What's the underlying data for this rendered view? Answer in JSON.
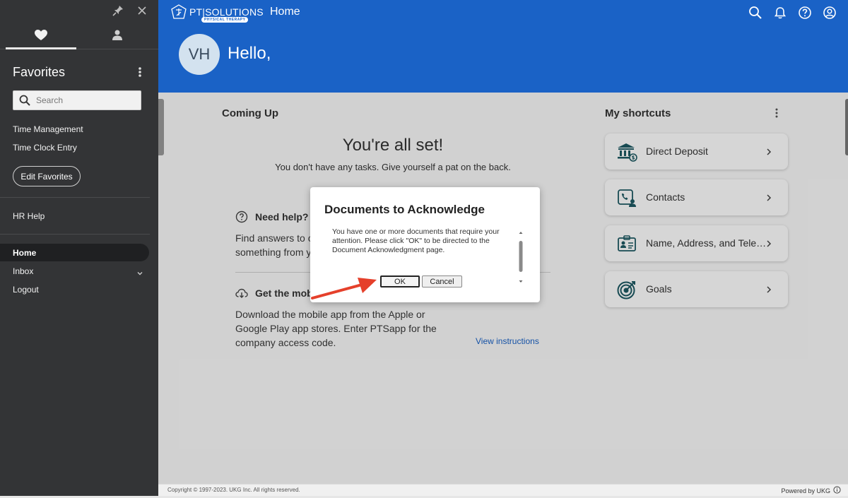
{
  "sidebar": {
    "title": "Favorites",
    "search_placeholder": "Search",
    "favorites": [
      "Time Management",
      "Time Clock Entry"
    ],
    "edit_favorites": "Edit Favorites",
    "hr_help": "HR Help",
    "nav": [
      {
        "label": "Home",
        "active": true
      },
      {
        "label": "Inbox",
        "has_chevron": true
      },
      {
        "label": "Logout"
      }
    ],
    "tabs": [
      {
        "icon": "heart-icon",
        "active": true
      },
      {
        "icon": "person-icon",
        "active": false
      }
    ]
  },
  "header": {
    "logo_text": "PT|SOLUTIONS",
    "logo_subtext": "PHYSICAL THERAPY",
    "page_name": "Home",
    "avatar_initials": "VH",
    "greeting": "Hello,",
    "icons": [
      "search-icon",
      "bell-icon",
      "help-icon",
      "account-icon"
    ]
  },
  "coming_up": {
    "title": "Coming Up",
    "headline": "You're all set!",
    "subtext": "You don't have any tasks. Give yourself a pat on the back."
  },
  "help": {
    "title": "Need help?",
    "text_line1": "Find answers to co",
    "text_line2": "something from yo"
  },
  "mobile": {
    "title": "Get the mobi",
    "text_line1": "Download the mobile app from the Apple or",
    "text_line2": "Google Play app stores. Enter PTSapp for the",
    "text_line3": "company access code.",
    "link": "View instructions"
  },
  "shortcuts": {
    "title": "My shortcuts",
    "items": [
      {
        "label": "Direct Deposit",
        "icon": "bank-icon"
      },
      {
        "label": "Contacts",
        "icon": "contacts-icon"
      },
      {
        "label": "Name, Address, and Tele…",
        "icon": "id-card-icon"
      },
      {
        "label": "Goals",
        "icon": "target-icon"
      }
    ]
  },
  "modal": {
    "title": "Documents to Acknowledge",
    "message": "You have one or more documents that require your attention. Please click \"OK\" to be directed to the Document Acknowledgment page.",
    "ok_label": "OK",
    "cancel_label": "Cancel"
  },
  "footer": {
    "copyright": "Copyright © 1997-2023. UKG Inc. All rights reserved.",
    "powered_by": "Powered by UKG"
  },
  "colors": {
    "header_blue": "#1a62c6",
    "sidebar_dark": "#333436",
    "accent_teal": "#1d5a63",
    "arrow_red": "#e5402b"
  }
}
